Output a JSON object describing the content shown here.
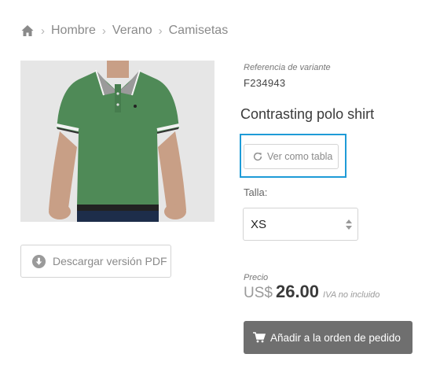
{
  "breadcrumb": {
    "home_icon": "home-icon",
    "items": [
      "Hombre",
      "Verano",
      "Camisetas"
    ]
  },
  "product": {
    "image_alt_icon": "green-polo-shirt-photo",
    "reference_label": "Referencia de variante",
    "reference_value": "F234943",
    "title": "Contrasting polo shirt"
  },
  "buttons": {
    "pdf_label": "Descargar versión PDF",
    "pdf_icon": "download-icon",
    "table_label": "Ver como tabla",
    "table_icon": "refresh-icon",
    "add_label": "Añadir a la orden de pedido",
    "add_icon": "cart-icon"
  },
  "size": {
    "label": "Talla:",
    "selected": "XS"
  },
  "price": {
    "label": "Precio",
    "currency": "US$",
    "amount": "26.00",
    "tax_note": "IVA no incluido"
  },
  "colors": {
    "accent_focus": "#1e9bd7",
    "primary_button": "#6f6f6f",
    "shirt_green": "#4f8a57"
  }
}
